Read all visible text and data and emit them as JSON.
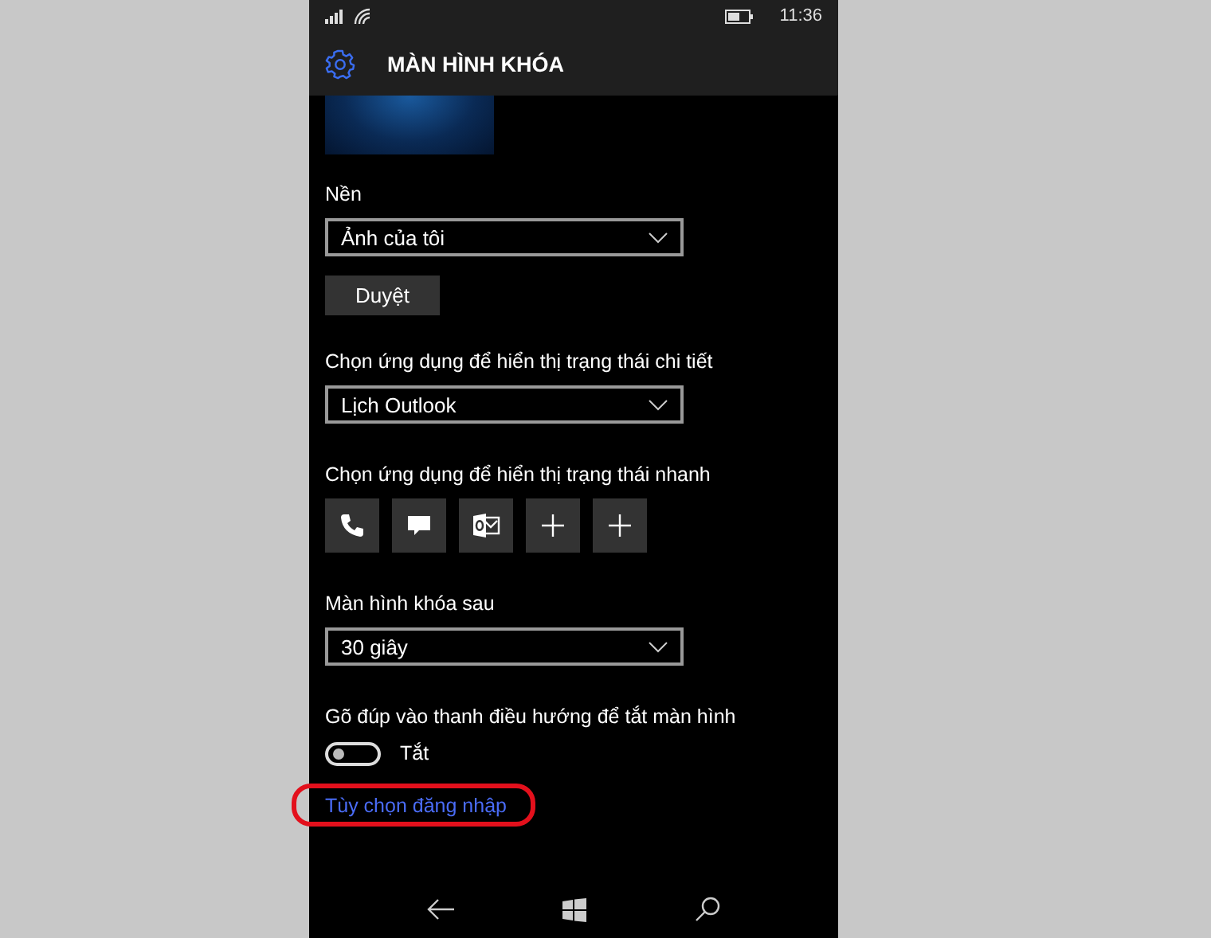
{
  "status_bar": {
    "time": "11:36"
  },
  "header": {
    "title": "MÀN HÌNH KHÓA"
  },
  "background": {
    "label": "Nền",
    "value": "Ảnh của tôi",
    "browse_button": "Duyệt"
  },
  "detailed_status": {
    "label": "Chọn ứng dụng để hiển thị trạng thái chi tiết",
    "value": "Lịch Outlook"
  },
  "quick_status": {
    "label": "Chọn ứng dụng để hiển thị trạng thái nhanh",
    "apps": [
      {
        "kind": "phone"
      },
      {
        "kind": "message"
      },
      {
        "kind": "outlook"
      },
      {
        "kind": "add"
      },
      {
        "kind": "add"
      }
    ]
  },
  "screen_timeout": {
    "label": "Màn hình khóa sau",
    "value": "30 giây"
  },
  "double_tap": {
    "label": "Gõ đúp vào thanh điều hướng để tắt màn hình",
    "on": false,
    "state_text": "Tắt"
  },
  "sign_in_link": {
    "text": "Tùy chọn đăng nhập",
    "highlighted": true
  }
}
